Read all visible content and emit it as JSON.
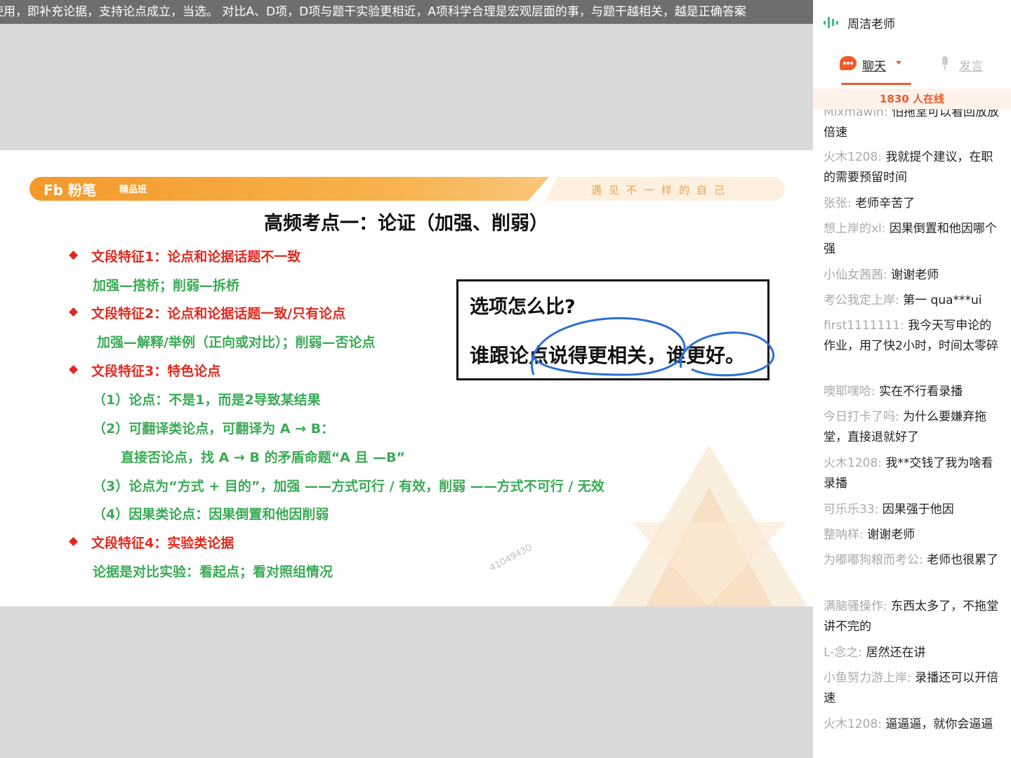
{
  "subtitle": "使用，即补充论据，支持论点成立，当选。 对比A、D项，D项与题干实验更相近，A项科学合理是宏观层面的事，与题干越相关，越是正确答案",
  "slide": {
    "brand": "粉笔",
    "logo_letters": "Fb",
    "class_label": "精品班",
    "slogan": "遇见不一样的自己",
    "title": "高频考点一：论证（加强、削弱）",
    "lines": [
      "文段特征1：论点和论据话题不一致",
      "加强—搭桥；削弱—拆桥",
      "文段特征2：论点和论据话题一致/只有论点",
      "加强—解释/举例（正向或对比）；削弱—否论点",
      "文段特征3：特色论点",
      "（1）论点：不是1，而是2导致某结果",
      "（2）可翻译类论点，可翻译为 A → B：",
      "直接否论点，找 A → B 的矛盾命题“A 且 —B”",
      "（3）论点为“方式 + 目的”，加强 ——方式可行 / 有效，削弱 ——方式不可行 / 无效",
      "（4）因果类论点：因果倒置和他因削弱",
      "文段特征4：实验类论据",
      "论据是对比实验：看起点；看对照组情况"
    ],
    "callout_question": "选项怎么比?",
    "callout_answer": "谁跟论点说得更相关，谁更好。",
    "watermark": "41049430"
  },
  "panel": {
    "teacher": "周洁老师",
    "tab_chat": "聊天",
    "tab_speak": "发言",
    "online": "1830 人在线",
    "messages": [
      {
        "user": "Mixmawin:",
        "text": "怕拖堂可以看回放放倍速"
      },
      {
        "user": "火木1208:",
        "text": "我就提个建议，在职的需要预留时间"
      },
      {
        "user": "张张:",
        "text": "老师辛苦了"
      },
      {
        "user": "想上岸的xl:",
        "text": "因果倒置和他因哪个强"
      },
      {
        "user": "小仙女茜茜:",
        "text": "谢谢老师"
      },
      {
        "user": "考公我定上岸:",
        "text": "第一 qua***ui"
      },
      {
        "user": "first1111111:",
        "text": "我今天写申论的作业，用了快2小时，时间太零碎"
      },
      {
        "user": "噢耶嘿哈:",
        "text": "实在不行看录播"
      },
      {
        "user": "今日打卡了吗:",
        "text": "为什么要嫌弃拖堂，直接退就好了"
      },
      {
        "user": "火木1208:",
        "text": "我**交钱了我为啥看录播"
      },
      {
        "user": "可乐乐33:",
        "text": "因果强于他因"
      },
      {
        "user": "整呐样:",
        "text": "谢谢老师"
      },
      {
        "user": "为嘟嘟狗粮而考公:",
        "text": "老师也很累了"
      },
      {
        "user": "满脑骚操作:",
        "text": "东西太多了，不拖堂讲不完的"
      },
      {
        "user": "L-念之:",
        "text": "居然还在讲"
      },
      {
        "user": "小鱼努力游上岸:",
        "text": "录播还可以开倍速"
      },
      {
        "user": "火木1208:",
        "text": "逼逼逼，就你会逼逼"
      }
    ]
  },
  "colors": {
    "accent": "#f05a2a",
    "banner_orange": "#f39a2a",
    "red_text": "#e02a20",
    "green_text": "#3aab55",
    "annotation_blue": "#2f6fd6"
  }
}
